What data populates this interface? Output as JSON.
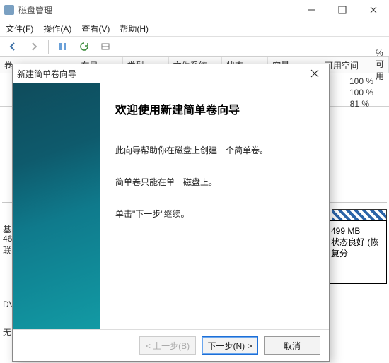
{
  "window": {
    "title": "磁盘管理"
  },
  "menubar": [
    "文件(F)",
    "操作(A)",
    "查看(V)",
    "帮助(H)"
  ],
  "table": {
    "headers": [
      "卷",
      "布局",
      "类型",
      "文件系统",
      "状态",
      "容量",
      "可用空间",
      "% 可用"
    ],
    "rows": [
      "100 %",
      "100 %",
      "81 %"
    ]
  },
  "lower": {
    "leftLabels": [
      "基",
      "46",
      "联",
      "",
      "DV",
      "无"
    ],
    "partition": {
      "size": "499 MB",
      "status": "状态良好 (恢复分"
    }
  },
  "wizard": {
    "title": "新建简单卷向导",
    "heading": "欢迎使用新建简单卷向导",
    "lines": [
      "此向导帮助你在磁盘上创建一个简单卷。",
      "简单卷只能在单一磁盘上。",
      "单击\"下一步\"继续。"
    ],
    "buttons": {
      "back": "< 上一步(B)",
      "next": "下一步(N) >",
      "cancel": "取消"
    }
  }
}
